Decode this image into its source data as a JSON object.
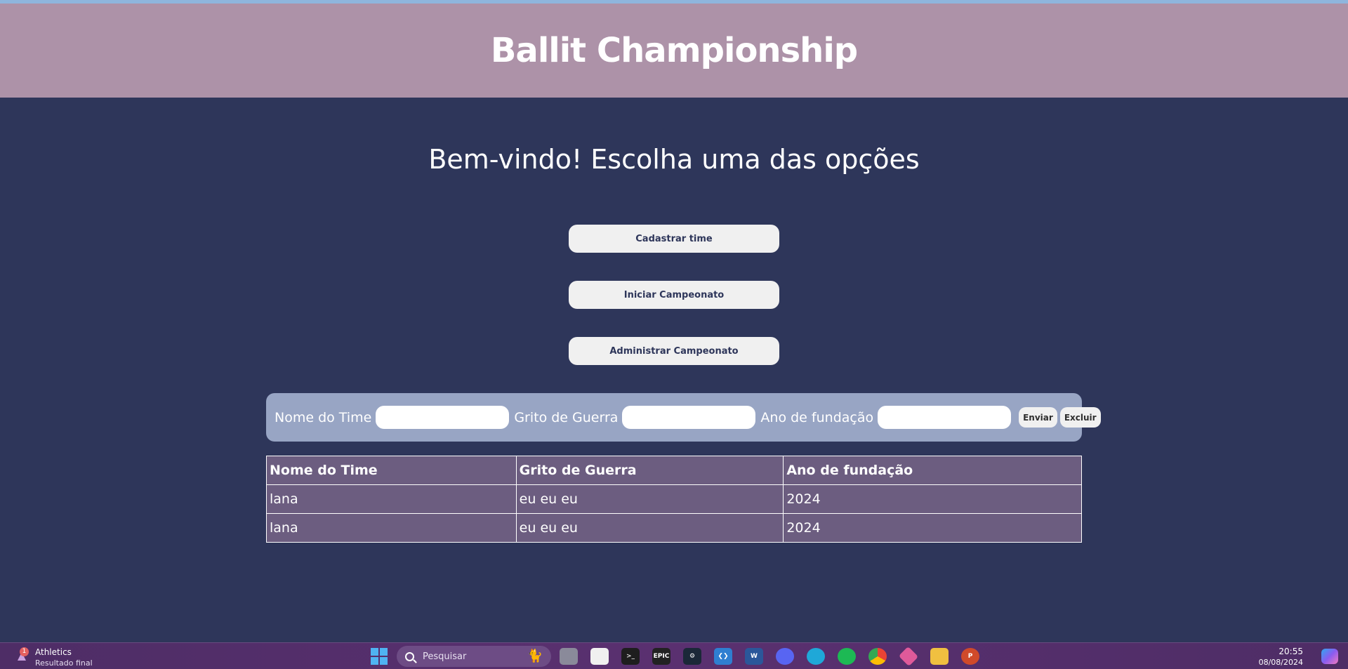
{
  "header": {
    "title": "Ballit Championship"
  },
  "main": {
    "welcome": "Bem-vindo! Escolha uma das opções",
    "buttons": [
      {
        "label": "Cadastrar time"
      },
      {
        "label": "Iniciar Campeonato"
      },
      {
        "label": "Administrar Campeonato"
      }
    ]
  },
  "form": {
    "name_label": "Nome do Time",
    "name_value": "",
    "cry_label": "Grito de Guerra",
    "cry_value": "",
    "year_label": "Ano de fundação",
    "year_value": "",
    "submit_label": "Enviar",
    "delete_label": "Excluir"
  },
  "table": {
    "headers": [
      "Nome do Time",
      "Grito de Guerra",
      "Ano de fundação"
    ],
    "rows": [
      [
        "lana",
        "eu eu eu",
        "2024"
      ],
      [
        "lana",
        "eu eu eu",
        "2024"
      ]
    ]
  },
  "taskbar": {
    "widget_title": "Athletics",
    "widget_subtitle": "Resultado final",
    "widget_badge": "1",
    "search_placeholder": "Pesquisar",
    "apps": [
      "file-explorer-window-icon",
      "snipping-tool-icon",
      "terminal-icon",
      "epic-games-icon",
      "steam-icon",
      "vscode-icon",
      "word-icon",
      "discord-icon",
      "edge-icon",
      "spotify-icon",
      "chrome-icon",
      "git-icon",
      "folder-icon",
      "powerpoint-icon"
    ],
    "epic_label": "EPIC",
    "word_label": "W",
    "powerpoint_label": "P",
    "time": "20:55",
    "date": "08/08/2024"
  },
  "colors": {
    "header_bg": "#ad92a8",
    "page_bg": "#2e365a",
    "form_bg": "#98a5c4",
    "table_bg": "#6c5d80"
  }
}
